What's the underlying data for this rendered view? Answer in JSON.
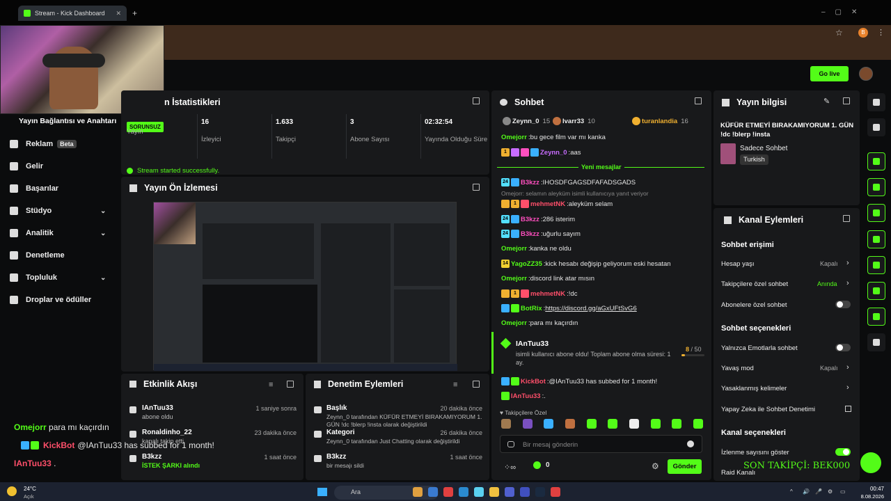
{
  "browser": {
    "tab_title": "Stream - Kick Dashboard",
    "profile_initial": "B"
  },
  "header": {
    "go_live": "Go live"
  },
  "sidebar": {
    "connection": "Yayın Bağlantısı ve Anahtarı",
    "items": [
      {
        "label": "Reklam",
        "badge": "Beta"
      },
      {
        "label": "Gelir"
      },
      {
        "label": "Başarılar"
      },
      {
        "label": "Stüdyo",
        "chevron": true
      },
      {
        "label": "Analitik",
        "chevron": true
      },
      {
        "label": "Denetleme"
      },
      {
        "label": "Topluluk",
        "chevron": true
      },
      {
        "label": "Droplar ve ödüller"
      }
    ]
  },
  "stats": {
    "title": "n İstatistikleri",
    "status_badge": "SORUNSUZ",
    "cols": [
      {
        "value": "",
        "label": "Yayın"
      },
      {
        "value": "16",
        "label": "İzleyici"
      },
      {
        "value": "1.633",
        "label": "Takipçi"
      },
      {
        "value": "3",
        "label": "Abone Sayısı"
      },
      {
        "value": "02:32:54",
        "label": "Yayında Olduğu Süre"
      }
    ],
    "success": "Stream started successfully."
  },
  "preview": {
    "title": "Yayın Ön İzlemesi"
  },
  "events": {
    "title": "Etkinlik Akışı",
    "items": [
      {
        "name": "IAnTuu33",
        "detail": "abone oldu",
        "time": "1 saniye sonra"
      },
      {
        "name": "Ronaldinho_22",
        "detail": "kanalı takip etti",
        "time": "23 dakika önce"
      },
      {
        "name": "B3kzz",
        "detail": "İSTEK ŞARKI alındı",
        "time": "1 saat önce"
      }
    ]
  },
  "moderation": {
    "title": "Denetim Eylemleri",
    "items": [
      {
        "name": "Başlık",
        "line1": "Zeynn_0 tarafından KÜFÜR ETMEYİ BIRAKAMIYORUM 1.",
        "line2": "GÜN !dc !blerp !insta olarak değiştirildi",
        "time": "20 dakika önce"
      },
      {
        "name": "Kategori",
        "line1": "Zeynn_0 tarafından Just Chatting olarak değiştirildi",
        "line2": "",
        "time": "26 dakika önce"
      },
      {
        "name": "B3kzz",
        "line1": "bir mesajı sildi",
        "line2": "",
        "time": "1 saat önce"
      }
    ]
  },
  "chat": {
    "title": "Sohbet",
    "top_users": [
      {
        "name": "Zeynn_0",
        "score": "15"
      },
      {
        "name": "Ivarr33",
        "score": "10"
      },
      {
        "name": "turanlandia",
        "score": "16"
      }
    ],
    "new_messages": "Yeni mesajlar",
    "messages": [
      {
        "user": "Omejorr",
        "color": "#53fc18",
        "text": "bu gece film var mı kanka"
      },
      {
        "user": "Zeynn_0",
        "color": "#c86cff",
        "text": "aas"
      },
      {
        "user": "B3kzz",
        "color": "#ff4fbf",
        "text": "IHOSDFGAGSDFAFADSGADS"
      },
      {
        "user": "mehmetNK",
        "color": "#ff4f6a",
        "text": "aleyküm selam",
        "reply": "Omejorr: selamın aleyküm isimli kullanıcıya yanıt veriyor"
      },
      {
        "user": "B3kzz",
        "color": "#ff4fbf",
        "text": "286 isterim"
      },
      {
        "user": "B3kzz",
        "color": "#ff4fbf",
        "text": "uğurlu sayım"
      },
      {
        "user": "Omejorr",
        "color": "#53fc18",
        "text": "kanka ne oldu"
      },
      {
        "user": "YagoZZ35",
        "color": "#53fc18",
        "text": "kick hesabı değişip geliyorum eski hesatan"
      },
      {
        "user": "Omejorr",
        "color": "#53fc18",
        "text": "discord link atar mısın"
      },
      {
        "user": "mehmetNK",
        "color": "#ff4f6a",
        "text": "!dc"
      },
      {
        "user": "BotRix",
        "color": "#53fc18",
        "text": "https://discord.gg/aGxUFtSvG6"
      },
      {
        "user": "Omejorr",
        "color": "#53fc18",
        "text": "para mı kaçırdın"
      }
    ],
    "sub_card": {
      "user": "IAnTuu33",
      "text": "isimli kullanıcı abone oldu! Toplam abone olma süresi: 1 ay.",
      "progress": "8",
      "goal": "50"
    },
    "after": [
      {
        "user": "KickBot",
        "color": "#ff4f6a",
        "text": "@IAnTuu33 has subbed for 1 month!"
      },
      {
        "user": "IAnTuu33",
        "color": "#ff4f6a",
        "text": "."
      }
    ],
    "follower_only": "Takipçilere Özel",
    "placeholder": "Bir mesaj gönderin",
    "count": "0",
    "send": "Gönder"
  },
  "stream_info": {
    "title": "Yayın bilgisi",
    "stream_title": "KÜFÜR ETMEYİ BIRAKAMIYORUM 1. GÜN !dc !blerp !insta",
    "category": "Sadece Sohbet",
    "language": "Turkish"
  },
  "channel_actions": {
    "title": "Kanal Eylemleri",
    "chat_access": "Sohbet erişimi",
    "account_age": "Hesap yaşı",
    "account_age_val": "Kapalı",
    "followers_chat": "Takipçilere özel sohbet",
    "followers_chat_val": "Anında",
    "subs_chat": "Abonelere özel sohbet",
    "chat_options": "Sohbet seçenekleri",
    "emotes_only": "Yalnızca Emotlarla sohbet",
    "slow_mode": "Yavaş mod",
    "slow_mode_val": "Kapalı",
    "banned_words": "Yasaklanmış kelimeler",
    "ai_mod": "Yapay Zeka ile Sohbet Denetimi",
    "channel_options": "Kanal seçenekleri",
    "show_viewers": "İzlenme sayısını göster",
    "raid": "Raid Kanalı"
  },
  "overlay": {
    "chat": [
      {
        "user": "Omejorr",
        "text": "para mı kaçırdın"
      },
      {
        "user": "KickBot",
        "text": "@IAnTuu33 has subbed for 1 month!"
      },
      {
        "user": "IAnTuu33",
        "text": "."
      }
    ],
    "last_follower": "SON TAKİPÇİ: BEK000"
  },
  "taskbar": {
    "weather_temp": "24°C",
    "weather_desc": "Açık",
    "search": "Ara",
    "time": "00:47",
    "date": "8.08.2026"
  }
}
